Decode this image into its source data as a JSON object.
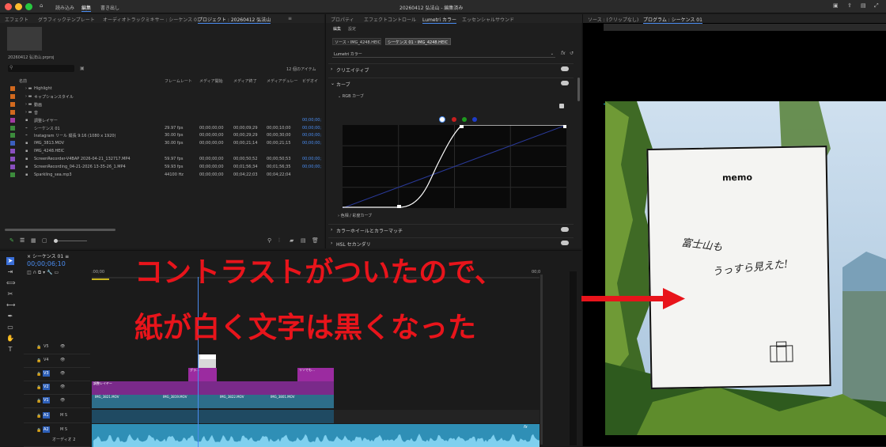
{
  "window": {
    "title": "20260412 弘法山 - 編集済み"
  },
  "menu": {
    "learn": "読み込み",
    "edit": "編集",
    "export": "書き出し"
  },
  "top_tabs": [
    "エフェクト",
    "グラフィックテンプレート",
    "オーディオトラックミキサー : シーケンス 01",
    "プロジェクト : 20260412 弘法山"
  ],
  "project": {
    "filename": "20260412 弘法山.prproj",
    "item_count": "12 個のアイテム",
    "columns": [
      "名前",
      "フレームレート",
      "メディア開始",
      "メディア終了",
      "メディアデュレー",
      "ビデオイ"
    ],
    "items": [
      {
        "name": "Highlight",
        "fps": "",
        "start": "",
        "end": "",
        "dur": "",
        "vin": "",
        "color": "#d2691e",
        "kind": "folder"
      },
      {
        "name": "キャプションスタイル",
        "fps": "",
        "start": "",
        "end": "",
        "dur": "",
        "vin": "",
        "color": "#d2691e",
        "kind": "folder"
      },
      {
        "name": "動画",
        "fps": "",
        "start": "",
        "end": "",
        "dur": "",
        "vin": "",
        "color": "#d2691e",
        "kind": "folder"
      },
      {
        "name": "音",
        "fps": "",
        "start": "",
        "end": "",
        "dur": "",
        "vin": "",
        "color": "#d2691e",
        "kind": "folder"
      },
      {
        "name": "調整レイヤー",
        "fps": "",
        "start": "",
        "end": "",
        "dur": "",
        "vin": "00;00;00;",
        "color": "#a23ba2",
        "kind": "item"
      },
      {
        "name": "シーケンス 01",
        "fps": "29.97 fps",
        "start": "00;00;00;00",
        "end": "00;00;09;29",
        "dur": "00;00;10;00",
        "vin": "00;00;00;",
        "color": "#3c8c3c",
        "kind": "seq"
      },
      {
        "name": "Instagram リール 縦長 9:16 (1080 x 1920)",
        "fps": "30.00 fps",
        "start": "00;00;00;00",
        "end": "00;00;29;29",
        "dur": "00;00;30;00",
        "vin": "00;00;00;",
        "color": "#3c8c3c",
        "kind": "seq"
      },
      {
        "name": "IMG_3813.MOV",
        "fps": "30.00 fps",
        "start": "00;00;00;00",
        "end": "00;00;21;14",
        "dur": "00;00;21;15",
        "vin": "00;00;00;",
        "color": "#3a5fbf",
        "kind": "item"
      },
      {
        "name": "IMG_4248.HEIC",
        "fps": "",
        "start": "",
        "end": "",
        "dur": "",
        "vin": "",
        "color": "#8a4fbf",
        "kind": "item"
      },
      {
        "name": "ScreenRecorder-V4BAP 2026-04-21_132717.MP4",
        "fps": "59.97 fps",
        "start": "00;00;00;00",
        "end": "00;00;50;52",
        "dur": "00;00;50;53",
        "vin": "00;00;00;",
        "color": "#8a4fbf",
        "kind": "item"
      },
      {
        "name": "ScreenRecording_04-21-2026 13-35-26_1.MP4",
        "fps": "59.93 fps",
        "start": "00;00;00;00",
        "end": "00;01;56;34",
        "dur": "00;01;56;35",
        "vin": "00;00;00;",
        "color": "#8a4fbf",
        "kind": "item"
      },
      {
        "name": "Sparkling_sea.mp3",
        "fps": "44100 Hz",
        "start": "00;00;00;00",
        "end": "00;04;22;03",
        "dur": "00;04;22;04",
        "vin": "",
        "color": "#3c8c3c",
        "kind": "item"
      }
    ]
  },
  "lumetri": {
    "tabs": [
      "プロパティ",
      "エフェクトコントロール",
      "Lumetri カラー",
      "エッセンシャルサウンド"
    ],
    "subtabs": [
      "編集",
      "設定"
    ],
    "source_label": "ソース・IMG_4248.HEIC",
    "seq_label": "シーケンス 01・IMG_4248.HEIC",
    "dropdown": "Lumetri カラー",
    "sections": [
      "クリエイティブ",
      "カーブ",
      "カラーホイールとカラーマッチ",
      "HSL セカンダリ"
    ],
    "rgb_curve": "RGB カーブ",
    "hue_sat": "色相 / 彩度カーブ",
    "fx": "fx"
  },
  "program": {
    "source_tab": "ソース : (クリップなし)",
    "program_tab": "プログラム : シーケンス 01",
    "memo_title": "memo",
    "handwriting_line1": "富士山も",
    "handwriting_line2": "うっすら見えた!"
  },
  "timeline": {
    "tab": "シーケンス 01",
    "timecode": "00;00;06;10",
    "ruler_start": ":00;00",
    "ruler_end": "00;0",
    "tracks": [
      "V5",
      "V4",
      "V3",
      "V2",
      "V1",
      "A1",
      "A2"
    ],
    "clip_v1": [
      "IMG_3821.MOV",
      "IMG_3819.MOV",
      "IMG_3822.MOV",
      "IMG_3801.MOV"
    ],
    "clip_v2": "調整レイヤー",
    "clip_v3": "リソでも…",
    "clip_v3b": "グラ…",
    "audio_label": "オーディオ 2",
    "fx": "fx"
  },
  "annotation": {
    "line1": "コントラストがついたので、",
    "line2": "紙が白く文字は黒くなった"
  }
}
